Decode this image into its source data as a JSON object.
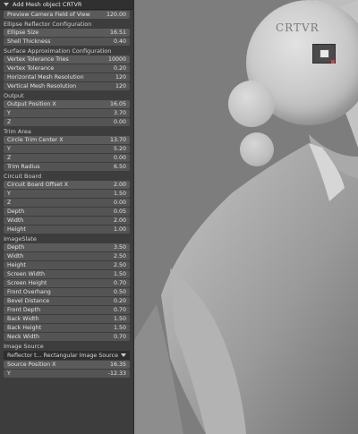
{
  "panel": {
    "title": "Add Mesh object CRTVR",
    "sections": [
      {
        "heading": null,
        "rows": [
          {
            "label": "Preview Camera Field of View",
            "value": "120.00"
          }
        ]
      },
      {
        "heading": "Ellipse Reflector Configuration",
        "rows": [
          {
            "label": "Ellipse Size",
            "value": "16.51"
          },
          {
            "label": "Shell Thickness",
            "value": "0.40"
          }
        ]
      },
      {
        "heading": "Surface Approximation Configuration",
        "rows": [
          {
            "label": "Vertex Tolerance Tries",
            "value": "10000"
          },
          {
            "label": "Vertex Tolerance",
            "value": "0.20"
          },
          {
            "label": "Horizontal Mesh Resolution",
            "value": "120"
          },
          {
            "label": "Vertical Mesh Resolution",
            "value": "120"
          }
        ]
      },
      {
        "heading": "Output",
        "rows": [
          {
            "label": "Output Position X",
            "value": "16.05"
          },
          {
            "label": "Y",
            "value": "3.70"
          },
          {
            "label": "Z",
            "value": "0.00"
          }
        ]
      },
      {
        "heading": "Trim Area",
        "rows": [
          {
            "label": "Circle Trim Center X",
            "value": "13.70"
          },
          {
            "label": "Y",
            "value": "5.20"
          },
          {
            "label": "Z",
            "value": "0.00"
          },
          {
            "label": "Trim Radius",
            "value": "6.50"
          }
        ]
      },
      {
        "heading": "Circuit Board",
        "rows": [
          {
            "label": "Circuit Board Offset X",
            "value": "2.00"
          },
          {
            "label": "Y",
            "value": "1.50"
          },
          {
            "label": "Z",
            "value": "0.00"
          },
          {
            "label": "Depth",
            "value": "0.05"
          },
          {
            "label": "Width",
            "value": "2.00"
          },
          {
            "label": "Height",
            "value": "1.00"
          }
        ]
      },
      {
        "heading": "ImageSlate",
        "rows": [
          {
            "label": "Depth",
            "value": "3.50"
          },
          {
            "label": "Width",
            "value": "2.50"
          },
          {
            "label": "Height",
            "value": "2.50"
          },
          {
            "label": "Screen Width",
            "value": "1.50"
          },
          {
            "label": "Screen Height",
            "value": "0.70"
          },
          {
            "label": "Front Overhang",
            "value": "0.50"
          },
          {
            "label": "Bevel Distance",
            "value": "0.20"
          },
          {
            "label": "Front Depth",
            "value": "0.70"
          },
          {
            "label": "Back Width",
            "value": "1.50"
          },
          {
            "label": "Back Height",
            "value": "1.50"
          },
          {
            "label": "Neck Width",
            "value": "0.70"
          }
        ]
      },
      {
        "heading": "Image Source",
        "dropdown": "Reflector t... Rectangular Image Source",
        "rows": [
          {
            "label": "Source Position X",
            "value": "16.35"
          },
          {
            "label": "Y",
            "value": "-12.33"
          }
        ]
      }
    ]
  },
  "viewport": {
    "label": "CRTVR"
  }
}
